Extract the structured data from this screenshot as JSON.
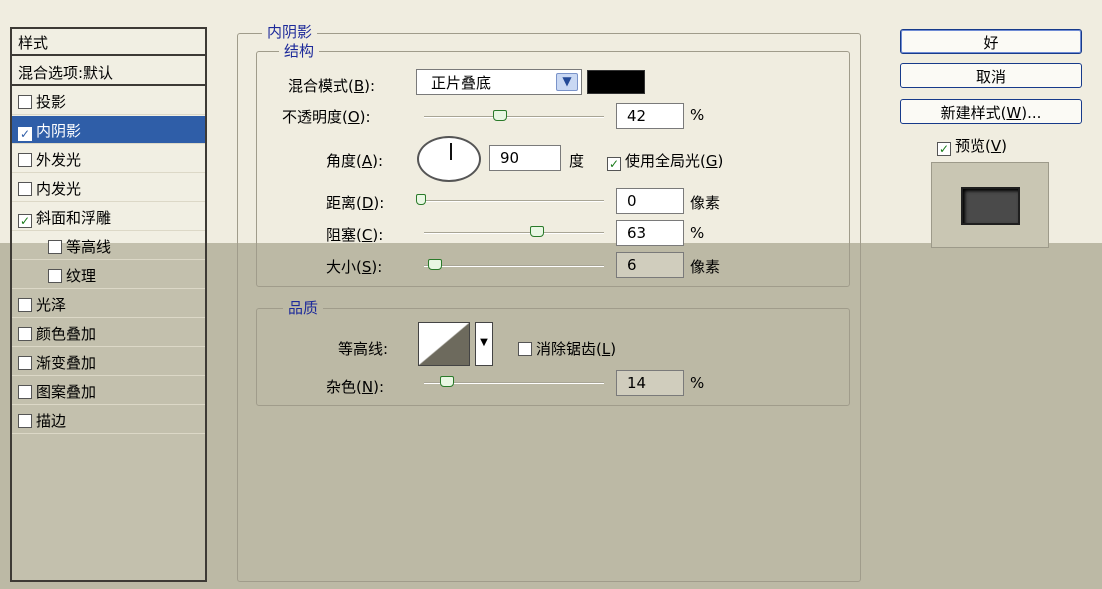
{
  "style_panel": {
    "header": "样式",
    "items": [
      {
        "label": "混合选项:默认",
        "checkbox": false,
        "checked": false,
        "selected": false,
        "sub": false
      },
      {
        "label": "投影",
        "checkbox": true,
        "checked": false,
        "selected": false,
        "sub": false
      },
      {
        "label": "内阴影",
        "checkbox": true,
        "checked": true,
        "selected": true,
        "sub": false
      },
      {
        "label": "外发光",
        "checkbox": true,
        "checked": false,
        "selected": false,
        "sub": false
      },
      {
        "label": "内发光",
        "checkbox": true,
        "checked": false,
        "selected": false,
        "sub": false
      },
      {
        "label": "斜面和浮雕",
        "checkbox": true,
        "checked": true,
        "selected": false,
        "sub": false
      },
      {
        "label": "等高线",
        "checkbox": true,
        "checked": false,
        "selected": false,
        "sub": true
      },
      {
        "label": "纹理",
        "checkbox": true,
        "checked": false,
        "selected": false,
        "sub": true
      },
      {
        "label": "光泽",
        "checkbox": true,
        "checked": false,
        "selected": false,
        "sub": false
      },
      {
        "label": "颜色叠加",
        "checkbox": true,
        "checked": false,
        "selected": false,
        "sub": false
      },
      {
        "label": "渐变叠加",
        "checkbox": true,
        "checked": false,
        "selected": false,
        "sub": false
      },
      {
        "label": "图案叠加",
        "checkbox": true,
        "checked": false,
        "selected": false,
        "sub": false
      },
      {
        "label": "描边",
        "checkbox": true,
        "checked": false,
        "selected": false,
        "sub": false
      }
    ]
  },
  "inner_shadow": {
    "title": "内阴影",
    "structure": {
      "title": "结构",
      "blend_mode_label": "混合模式(",
      "blend_mode_key": "B",
      "blend_mode_value": "正片叠底",
      "shadow_color": "#000000",
      "opacity_label": "不透明度(",
      "opacity_key": "O",
      "opacity_value": "42",
      "opacity_unit": "%",
      "opacity_level": 42,
      "angle_label": "角度(",
      "angle_key": "A",
      "angle_value": "90",
      "angle_unit": "度",
      "global_light_label": "使用全局光(",
      "global_light_key": "G",
      "global_light_checked": true,
      "distance_label": "距离(",
      "distance_key": "D",
      "distance_value": "0",
      "distance_unit": "像素",
      "choke_label": "阻塞(",
      "choke_key": "C",
      "choke_value": "63",
      "choke_unit": "%",
      "size_label": "大小(",
      "size_key": "S",
      "size_value": "6",
      "size_unit": "像素"
    },
    "quality": {
      "title": "品质",
      "contour_label": "等高线:",
      "anti_alias_label": "消除锯齿(",
      "anti_alias_key": "L",
      "anti_alias_checked": false,
      "noise_label": "杂色(",
      "noise_key": "N",
      "noise_value": "14",
      "noise_unit": "%"
    }
  },
  "buttons": {
    "ok": "好",
    "cancel": "取消",
    "new_style_prefix": "新建样式(",
    "new_style_key": "W",
    "new_style_suffix": ")..."
  },
  "preview": {
    "label_prefix": "预览(",
    "key": "V",
    "checked": true
  },
  "common": {
    "close_paren_colon": "):",
    "close_paren": ")"
  }
}
